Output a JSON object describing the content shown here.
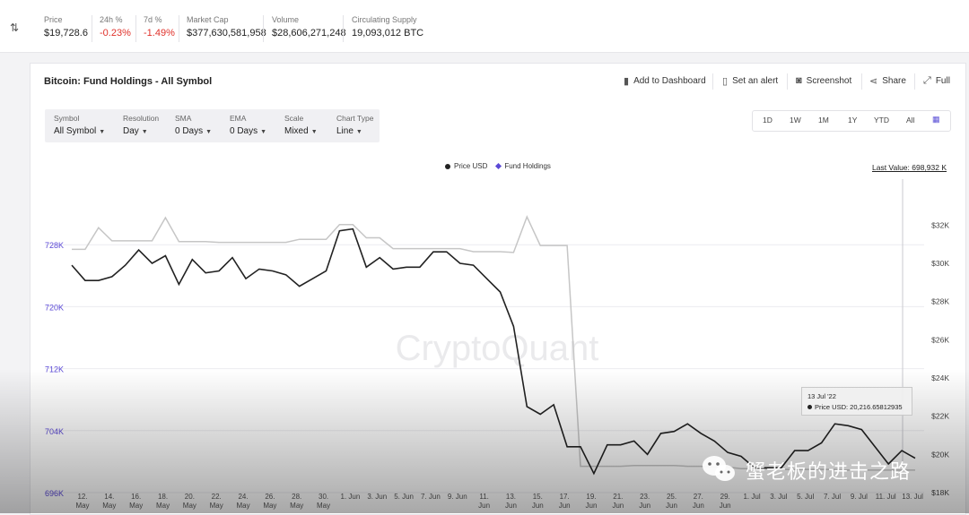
{
  "ticker": [
    {
      "label": "Price",
      "value": "$19,728.6",
      "negative": false
    },
    {
      "label": "24h %",
      "value": "-0.23%",
      "negative": true
    },
    {
      "label": "7d %",
      "value": "-1.49%",
      "negative": true
    },
    {
      "label": "Market Cap",
      "value": "$377,630,581,958",
      "negative": false
    },
    {
      "label": "Volume",
      "value": "$28,606,271,248",
      "negative": false
    },
    {
      "label": "Circulating Supply",
      "value": "19,093,012 BTC",
      "negative": false
    }
  ],
  "panel": {
    "title": "Bitcoin: Fund Holdings - All Symbol",
    "actions": [
      {
        "label": "Add to Dashboard",
        "icon": "dashboard-icon"
      },
      {
        "label": "Set an alert",
        "icon": "bell-icon"
      },
      {
        "label": "Screenshot",
        "icon": "camera-icon"
      },
      {
        "label": "Share",
        "icon": "share-icon"
      },
      {
        "label": "Full",
        "icon": "fullscreen-icon"
      }
    ]
  },
  "controls": [
    {
      "label": "Symbol",
      "value": "All Symbol"
    },
    {
      "label": "Resolution",
      "value": "Day"
    },
    {
      "label": "SMA",
      "value": "0 Days"
    },
    {
      "label": "EMA",
      "value": "0 Days"
    },
    {
      "label": "Scale",
      "value": "Mixed"
    },
    {
      "label": "Chart Type",
      "value": "Line"
    }
  ],
  "ranges": [
    "1D",
    "1W",
    "1M",
    "1Y",
    "YTD",
    "All"
  ],
  "legend": {
    "price": "Price USD",
    "holdings": "Fund Holdings"
  },
  "last_value": "Last Value: 698,932 K",
  "watermark": "CryptoQuant",
  "overlay_text": "蟹老板的进击之路",
  "tooltip": {
    "date": "13 Jul '22",
    "line": "Price USD: 20,216.65812935"
  },
  "colors": {
    "price": "#222222",
    "holdings": "#c6c6c6",
    "accent": "#5b49d6",
    "negative": "#e0312a"
  },
  "chart_data": {
    "type": "line",
    "x_ticks": [
      "12.\nMay",
      "14.\nMay",
      "16.\nMay",
      "18.\nMay",
      "20.\nMay",
      "22.\nMay",
      "24.\nMay",
      "26.\nMay",
      "28.\nMay",
      "30.\nMay",
      "1. Jun",
      "3. Jun",
      "5. Jun",
      "7. Jun",
      "9. Jun",
      "11.\nJun",
      "13.\nJun",
      "15.\nJun",
      "17.\nJun",
      "19.\nJun",
      "21.\nJun",
      "23.\nJun",
      "25.\nJun",
      "27.\nJun",
      "29.\nJun",
      "1. Jul",
      "3. Jul",
      "5. Jul",
      "7. Jul",
      "9. Jul",
      "11. Jul",
      "13. Jul"
    ],
    "y_left_ticks": [
      "728K",
      "720K",
      "712K",
      "704K",
      "696K"
    ],
    "y_left_values": [
      728,
      720,
      712,
      704,
      696
    ],
    "y_left_range": [
      696,
      733
    ],
    "y_right_ticks": [
      "$32K",
      "$30K",
      "$28K",
      "$26K",
      "$24K",
      "$22K",
      "$20K",
      "$18K"
    ],
    "y_right_values": [
      32,
      30,
      28,
      26,
      24,
      22,
      20,
      18
    ],
    "y_right_range": [
      18,
      33
    ],
    "day_range": [
      0,
      63
    ],
    "series": [
      {
        "name": "Price USD",
        "axis": "right",
        "unit": "$K",
        "values": [
          [
            0,
            29.9
          ],
          [
            1,
            29.1
          ],
          [
            2,
            29.1
          ],
          [
            3,
            29.3
          ],
          [
            4,
            29.9
          ],
          [
            5,
            30.7
          ],
          [
            6,
            30.0
          ],
          [
            7,
            30.4
          ],
          [
            8,
            28.9
          ],
          [
            9,
            30.2
          ],
          [
            10,
            29.5
          ],
          [
            11,
            29.6
          ],
          [
            12,
            30.3
          ],
          [
            13,
            29.2
          ],
          [
            14,
            29.7
          ],
          [
            15,
            29.6
          ],
          [
            16,
            29.4
          ],
          [
            17,
            28.8
          ],
          [
            18,
            29.2
          ],
          [
            19,
            29.6
          ],
          [
            20,
            31.7
          ],
          [
            21,
            31.8
          ],
          [
            22,
            29.8
          ],
          [
            23,
            30.3
          ],
          [
            24,
            29.7
          ],
          [
            25,
            29.8
          ],
          [
            26,
            29.8
          ],
          [
            27,
            30.6
          ],
          [
            28,
            30.6
          ],
          [
            29,
            30.0
          ],
          [
            30,
            29.9
          ],
          [
            31,
            29.2
          ],
          [
            32,
            28.5
          ],
          [
            33,
            26.7
          ],
          [
            34,
            22.5
          ],
          [
            35,
            22.1
          ],
          [
            36,
            22.6
          ],
          [
            37,
            20.4
          ],
          [
            38,
            20.4
          ],
          [
            39,
            19.0
          ],
          [
            40,
            20.5
          ],
          [
            41,
            20.5
          ],
          [
            42,
            20.7
          ],
          [
            43,
            20.0
          ],
          [
            44,
            21.1
          ],
          [
            45,
            21.2
          ],
          [
            46,
            21.6
          ],
          [
            47,
            21.1
          ],
          [
            48,
            20.7
          ],
          [
            49,
            20.1
          ],
          [
            50,
            19.9
          ],
          [
            51,
            19.3
          ],
          [
            52,
            19.3
          ],
          [
            53,
            19.3
          ],
          [
            54,
            20.2
          ],
          [
            55,
            20.2
          ],
          [
            56,
            20.6
          ],
          [
            57,
            21.6
          ],
          [
            58,
            21.5
          ],
          [
            59,
            21.3
          ],
          [
            60,
            20.4
          ],
          [
            61,
            19.5
          ],
          [
            62,
            20.2
          ],
          [
            63,
            19.8
          ]
        ]
      },
      {
        "name": "Fund Holdings",
        "axis": "left",
        "unit": "K",
        "values": [
          [
            0,
            727.4
          ],
          [
            1,
            727.4
          ],
          [
            2,
            730.2
          ],
          [
            3,
            728.5
          ],
          [
            4,
            728.5
          ],
          [
            5,
            728.5
          ],
          [
            6,
            728.5
          ],
          [
            7,
            731.5
          ],
          [
            8,
            728.4
          ],
          [
            9,
            728.4
          ],
          [
            10,
            728.4
          ],
          [
            11,
            728.3
          ],
          [
            12,
            728.3
          ],
          [
            13,
            728.3
          ],
          [
            14,
            728.3
          ],
          [
            15,
            728.3
          ],
          [
            16,
            728.3
          ],
          [
            17,
            728.7
          ],
          [
            18,
            728.7
          ],
          [
            19,
            728.7
          ],
          [
            20,
            730.6
          ],
          [
            21,
            730.6
          ],
          [
            22,
            728.9
          ],
          [
            23,
            728.9
          ],
          [
            24,
            727.5
          ],
          [
            25,
            727.5
          ],
          [
            26,
            727.5
          ],
          [
            27,
            727.5
          ],
          [
            28,
            727.5
          ],
          [
            29,
            727.5
          ],
          [
            30,
            727.1
          ],
          [
            31,
            727.1
          ],
          [
            32,
            727.1
          ],
          [
            33,
            727.0
          ],
          [
            34,
            731.6
          ],
          [
            35,
            727.9
          ],
          [
            36,
            727.9
          ],
          [
            37,
            727.9
          ],
          [
            38,
            699.4
          ],
          [
            39,
            699.4
          ],
          [
            40,
            699.4
          ],
          [
            41,
            699.4
          ],
          [
            42,
            699.5
          ],
          [
            43,
            699.5
          ],
          [
            44,
            699.5
          ],
          [
            45,
            699.5
          ],
          [
            46,
            699.4
          ],
          [
            47,
            699.4
          ],
          [
            48,
            699.3
          ],
          [
            49,
            699.3
          ],
          [
            50,
            699.1
          ],
          [
            51,
            699.1
          ],
          [
            52,
            699.1
          ],
          [
            53,
            699.0
          ],
          [
            54,
            699.0
          ],
          [
            55,
            699.0
          ],
          [
            56,
            699.0
          ],
          [
            57,
            699.0
          ],
          [
            58,
            698.9
          ],
          [
            59,
            698.9
          ],
          [
            60,
            698.9
          ],
          [
            61,
            698.9
          ],
          [
            62,
            698.9
          ],
          [
            63,
            698.9
          ]
        ]
      }
    ]
  }
}
